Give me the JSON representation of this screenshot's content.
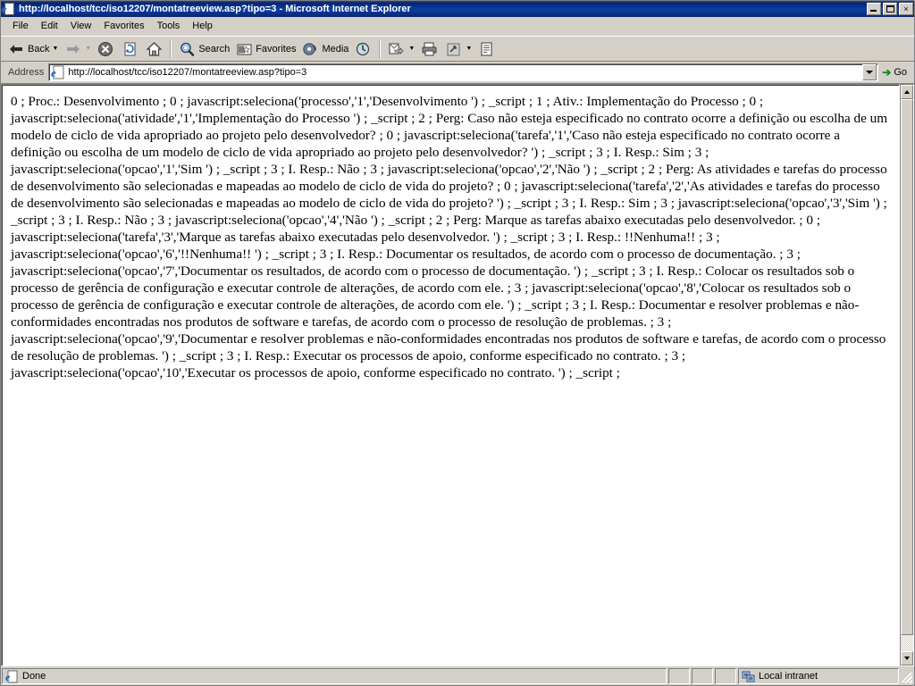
{
  "window": {
    "title": "http://localhost/tcc/iso12207/montatreeview.asp?tipo=3 - Microsoft Internet Explorer",
    "title_icon": "ie-page-icon",
    "minimize_label": "Minimize",
    "maximize_label": "Restore",
    "close_label": "×"
  },
  "menu": {
    "items": [
      {
        "label": "File",
        "name": "menu-file"
      },
      {
        "label": "Edit",
        "name": "menu-edit"
      },
      {
        "label": "View",
        "name": "menu-view"
      },
      {
        "label": "Favorites",
        "name": "menu-favorites"
      },
      {
        "label": "Tools",
        "name": "menu-tools"
      },
      {
        "label": "Help",
        "name": "menu-help"
      }
    ]
  },
  "toolbar": {
    "back_label": "Back",
    "forward_label": "",
    "stop_label": "",
    "refresh_label": "",
    "home_label": "",
    "search_label": "Search",
    "favorites_label": "Favorites",
    "media_label": "Media",
    "history_label": "",
    "mail_label": "",
    "print_label": "",
    "edit_label": "",
    "discuss_label": ""
  },
  "address": {
    "label": "Address",
    "url": "http://localhost/tcc/iso12207/montatreeview.asp?tipo=3",
    "go_label": "Go",
    "icon": "ie-page-icon"
  },
  "page": {
    "text": "0 ; Proc.: Desenvolvimento ; 0 ; javascript:seleciona('processo','1','Desenvolvimento ') ; _script ; 1 ; Ativ.: Implementação do Processo ; 0 ; javascript:seleciona('atividade','1','Implementação do Processo ') ; _script ; 2 ; Perg: Caso não esteja especificado no contrato ocorre a definição ou escolha de um modelo de ciclo de vida apropriado ao projeto pelo desenvolvedor? ; 0 ; javascript:seleciona('tarefa','1','Caso não esteja especificado no contrato ocorre a definição ou escolha de um modelo de ciclo de vida apropriado ao projeto pelo desenvolvedor? ') ; _script ; 3 ; I. Resp.: Sim ; 3 ; javascript:seleciona('opcao','1','Sim ') ; _script ; 3 ; I. Resp.: Não ; 3 ; javascript:seleciona('opcao','2','Não ') ; _script ; 2 ; Perg: As atividades e tarefas do processo de desenvolvimento são selecionadas e mapeadas ao modelo de ciclo de vida do projeto? ; 0 ; javascript:seleciona('tarefa','2','As atividades e tarefas do processo de desenvolvimento são selecionadas e mapeadas ao modelo de ciclo de vida do projeto? ') ; _script ; 3 ; I. Resp.: Sim ; 3 ; javascript:seleciona('opcao','3','Sim ') ; _script ; 3 ; I. Resp.: Não ; 3 ; javascript:seleciona('opcao','4','Não ') ; _script ; 2 ; Perg: Marque as tarefas abaixo executadas pelo desenvolvedor. ; 0 ; javascript:seleciona('tarefa','3','Marque as tarefas abaixo executadas pelo desenvolvedor. ') ; _script ; 3 ; I. Resp.: !!Nenhuma!! ; 3 ; javascript:seleciona('opcao','6','!!Nenhuma!! ') ; _script ; 3 ; I. Resp.: Documentar os resultados, de acordo com o processo de documentação. ; 3 ; javascript:seleciona('opcao','7','Documentar os resultados, de acordo com o processo de documentação. ') ; _script ; 3 ; I. Resp.: Colocar os resultados sob o processo de gerência de configuração e executar controle de alterações, de acordo com ele. ; 3 ; javascript:seleciona('opcao','8','Colocar os resultados sob o processo de gerência de configuração e executar controle de alterações, de acordo com ele. ') ; _script ; 3 ; I. Resp.: Documentar e resolver problemas e não-conformidades encontradas nos produtos de software e tarefas, de acordo com o processo de resolução de problemas. ; 3 ; javascript:seleciona('opcao','9','Documentar e resolver problemas e não-conformidades encontradas nos produtos de software e tarefas, de acordo com o processo de resolução de problemas. ') ; _script ; 3 ; I. Resp.: Executar os processos de apoio, conforme especificado no contrato. ; 3 ; javascript:seleciona('opcao','10','Executar os processos de apoio, conforme especificado no contrato. ') ; _script ;"
  },
  "status": {
    "message": "Done",
    "zone": "Local intranet",
    "zone_icon": "intranet-zone-icon",
    "status_icon": "ie-page-icon"
  }
}
